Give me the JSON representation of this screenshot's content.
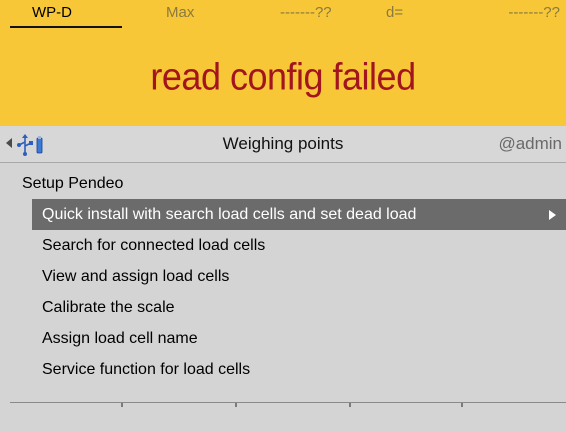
{
  "header": {
    "device": "WP-D",
    "max_label": "Max",
    "max_value": "-------??",
    "d_label": "d=",
    "d_value": "-------??",
    "background_color": "#f8c737"
  },
  "error": {
    "message": "read config failed",
    "color": "#a3151e"
  },
  "nav": {
    "back_icon": "arrow-left-icon",
    "device_icon": "usb-icon",
    "title": "Weighing points",
    "user": "@admin"
  },
  "menu": {
    "title": "Setup Pendeo",
    "items": [
      {
        "label": "Quick install with search load cells and set dead load",
        "selected": true,
        "has_submenu": true
      },
      {
        "label": "Search for connected load cells"
      },
      {
        "label": "View and assign load cells"
      },
      {
        "label": "Calibrate the scale"
      },
      {
        "label": "Assign load cell name"
      },
      {
        "label": "Service function for load cells"
      }
    ]
  }
}
